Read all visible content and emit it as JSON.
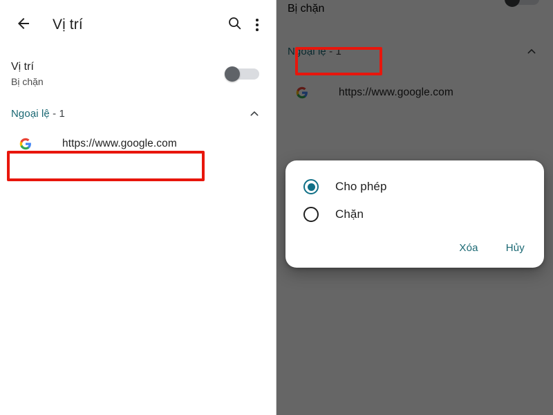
{
  "app": {
    "title": "Vị trí",
    "back_icon": "arrow-back-icon",
    "search_icon": "search-icon",
    "overflow_icon": "more-vert-icon"
  },
  "left_panel": {
    "master_toggle": {
      "title": "Vị trí",
      "subtitle": "Bị chặn",
      "state": "off"
    },
    "section": {
      "label": "Ngoại lệ",
      "count": " - 1",
      "expanded": true,
      "collapse_icon": "chevron-up-icon"
    },
    "site": {
      "favicon": "google-favicon",
      "url": "https://www.google.com"
    },
    "highlight": {
      "target": "site-row",
      "color": "#e8160c"
    }
  },
  "right_panel": {
    "scrolled_subtitle": "Bị chặn",
    "section": {
      "label": "Ngoại lệ",
      "count": " - 1",
      "collapse_icon": "chevron-up-icon"
    },
    "site": {
      "favicon": "google-favicon",
      "url": "https://www.google.com"
    },
    "scrim_color": "#646464",
    "dialog": {
      "options": [
        {
          "label": "Cho phép",
          "selected": true
        },
        {
          "label": "Chặn",
          "selected": false
        }
      ],
      "actions": [
        {
          "label": "Xóa",
          "name": "delete-button"
        },
        {
          "label": "Hủy",
          "name": "cancel-button"
        }
      ],
      "accent_color": "#0f6f86",
      "action_color": "#1a6873"
    },
    "highlight": {
      "target": "radio-option-block",
      "color": "#e8160c"
    }
  }
}
